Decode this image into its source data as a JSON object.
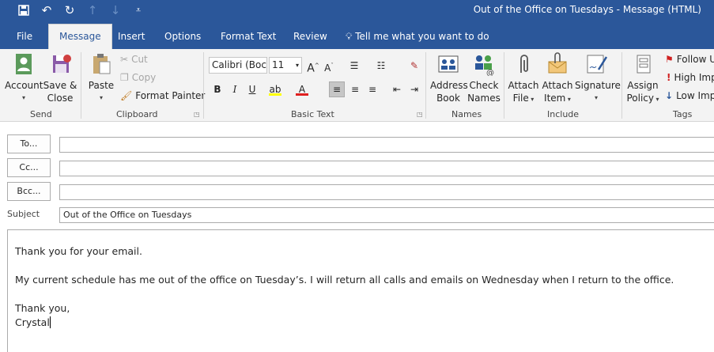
{
  "window": {
    "title": "Out of the Office on Tuesdays  -  Message (HTML)"
  },
  "quick_access": [
    "save-icon",
    "undo-icon",
    "redo-icon",
    "up-arrow-icon",
    "down-arrow-icon",
    "customize-icon"
  ],
  "tabs": [
    {
      "label": "File"
    },
    {
      "label": "Message"
    },
    {
      "label": "Insert"
    },
    {
      "label": "Options"
    },
    {
      "label": "Format Text"
    },
    {
      "label": "Review"
    }
  ],
  "tell_me": "Tell me what you want to do",
  "ribbon": {
    "send": {
      "label": "Send",
      "account": "Account",
      "save_close_1": "Save &",
      "save_close_2": "Close"
    },
    "clipboard": {
      "label": "Clipboard",
      "paste": "Paste",
      "cut": "Cut",
      "copy": "Copy",
      "format_painter": "Format Painter"
    },
    "basic_text": {
      "label": "Basic Text",
      "font": "Calibri (Boc",
      "size": "11",
      "bold": "B",
      "italic": "I",
      "underline": "U"
    },
    "names": {
      "label": "Names",
      "address_1": "Address",
      "address_2": "Book",
      "check_1": "Check",
      "check_2": "Names"
    },
    "include": {
      "label": "Include",
      "attach_file_1": "Attach",
      "attach_file_2": "File",
      "attach_item_1": "Attach",
      "attach_item_2": "Item",
      "signature": "Signature"
    },
    "tags": {
      "label": "Tags",
      "assign_1": "Assign",
      "assign_2": "Policy",
      "follow_up": "Follow U",
      "high_imp": "High Imp",
      "low_imp": "Low Imp"
    }
  },
  "fields": {
    "to_label": "To...",
    "cc_label": "Cc...",
    "bcc_label": "Bcc...",
    "subject_label": "Subject",
    "subject_value": "Out of the Office on Tuesdays"
  },
  "body": {
    "line1": "Thank you for your email.",
    "line2": "My current schedule has me out of the office on Tuesday’s. I will return all calls and emails on Wednesday when I return to the office.",
    "line3": "Thank you,",
    "line4": "Crystal"
  }
}
